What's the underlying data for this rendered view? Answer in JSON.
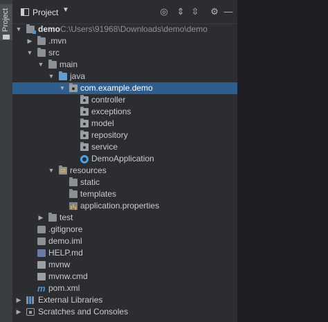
{
  "sidebar": {
    "tab_label": "Project"
  },
  "toolbar": {
    "title": "Project",
    "dropdown_glyph": "▼",
    "buttons": [
      {
        "name": "locate-icon",
        "glyph": "◎"
      },
      {
        "name": "expand-all-icon",
        "glyph": "⇕"
      },
      {
        "name": "collapse-all-icon",
        "glyph": "⇳"
      },
      {
        "name": "gear-icon",
        "glyph": "⚙"
      },
      {
        "name": "minimize-icon",
        "glyph": "—"
      }
    ]
  },
  "tree": {
    "demo": {
      "label": "demo",
      "path": "C:\\Users\\91968\\Downloads\\demo\\demo"
    },
    "mvn": ".mvn",
    "src": "src",
    "main": "main",
    "java": "java",
    "package": "com.example.demo",
    "controller": "controller",
    "exceptions": "exceptions",
    "model": "model",
    "repository": "repository",
    "service": "service",
    "app": "DemoApplication",
    "resources": "resources",
    "static": "static",
    "templates": "templates",
    "properties": "application.properties",
    "test": "test",
    "gitignore": ".gitignore",
    "iml": "demo.iml",
    "help": "HELP.md",
    "mvnw": "mvnw",
    "mvnwcmd": "mvnw.cmd",
    "pom": "pom.xml",
    "ext": "External Libraries",
    "scratches": "Scratches and Consoles"
  }
}
